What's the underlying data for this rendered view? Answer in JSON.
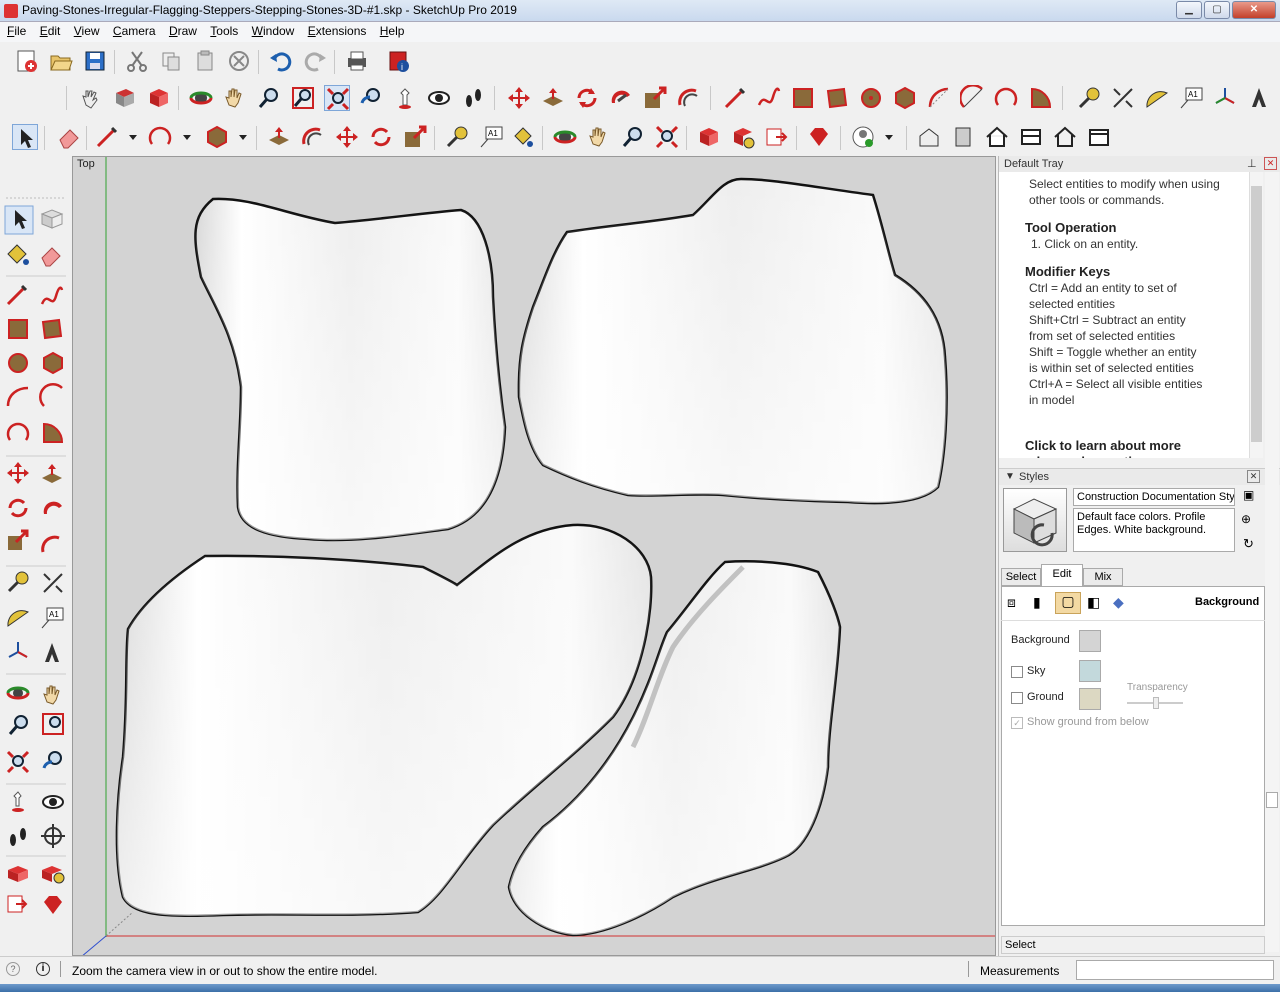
{
  "window": {
    "title": "Paving-Stones-Irregular-Flagging-Steppers-Stepping-Stones-3D-#1.skp - SketchUp Pro 2019",
    "buttons": [
      "minimize",
      "maximize",
      "close"
    ]
  },
  "menu": {
    "items": [
      "File",
      "Edit",
      "View",
      "Camera",
      "Draw",
      "Tools",
      "Window",
      "Extensions",
      "Help"
    ]
  },
  "viewport": {
    "view_label": "Top",
    "colors": {
      "background": "#d3d3d3",
      "red_axis": "#d03030",
      "green_axis": "#30a030",
      "blue_axis": "#3050d0"
    }
  },
  "tray": {
    "title": "Default Tray",
    "instructor": {
      "intro": "Select entities to modify when using other tools or commands.",
      "tool_operation_heading": "Tool Operation",
      "tool_operation_step": "1. Click on an entity.",
      "modifier_keys_heading": "Modifier Keys",
      "modifier_keys": [
        "Ctrl = Add an entity to set of",
        "selected entities",
        "Shift+Ctrl = Subtract an entity",
        "from set of selected entities",
        "Shift = Toggle whether an entity",
        "is within set of selected entities",
        "Ctrl+A = Select all visible entities",
        "in model"
      ],
      "learn_more": "Click to learn about more advanced operations..."
    },
    "styles": {
      "panel_title": "Styles",
      "style_name": "Construction Documentation Sty",
      "style_description": "Default face colors. Profile Edges. White background.",
      "tabs": [
        "Select",
        "Edit",
        "Mix"
      ],
      "active_tab": "Edit",
      "section_label": "Background",
      "background_label": "Background",
      "sky_label": "Sky",
      "ground_label": "Ground",
      "transparency_label": "Transparency",
      "show_ground_label": "Show ground from below",
      "colors": {
        "background": "#d4d4d4",
        "sky": "#c3d9dc",
        "ground": "#dcd8c2"
      },
      "sky_checked": false,
      "ground_checked": false,
      "show_ground_checked": true
    },
    "bottom_label": "Select"
  },
  "status": {
    "message": "Zoom the camera view in or out to show the entire model.",
    "measurements_label": "Measurements",
    "measurements_value": ""
  }
}
